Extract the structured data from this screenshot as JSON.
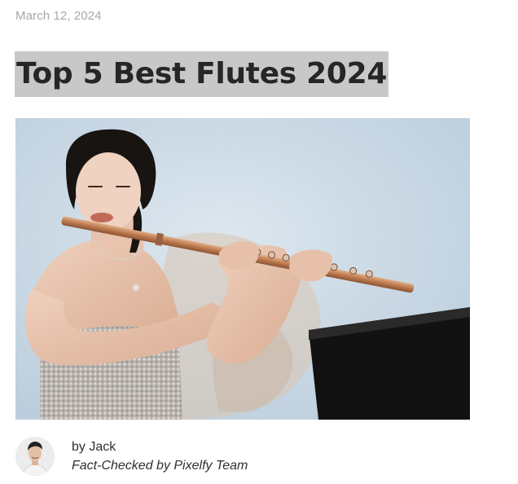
{
  "post": {
    "date": "March 12, 2024",
    "title": "Top 5 Best Flutes 2024"
  },
  "hero_image": {
    "icon": "photo-woman-playing-flute"
  },
  "author": {
    "avatar_icon": "author-avatar",
    "byline": "by Jack",
    "fact_checked": "Fact-Checked by Pixelfy Team"
  },
  "colors": {
    "title_highlight": "#c8c8c8",
    "title_text": "#262626",
    "date_text": "#a8a8a8",
    "wall": "#ccdbe7",
    "flute": "#c98a5e",
    "piano": "#121212"
  }
}
